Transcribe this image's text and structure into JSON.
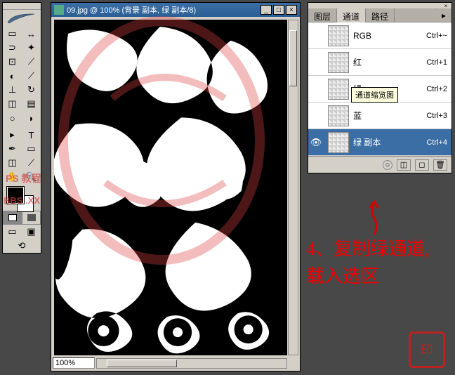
{
  "toolbox": {
    "tools": [
      "▭",
      "⬚",
      "⊡",
      "✎",
      "⟋",
      "⬛",
      "⬚",
      "⬚",
      "⬚",
      "✎",
      "⬚",
      "⬚",
      "⬚",
      "⬚",
      "⬚",
      "T",
      "⬚",
      "⬚",
      "⬚",
      "⬚",
      "⬚",
      "⬚"
    ]
  },
  "document": {
    "title": "09.jpg @ 100% (背景 副本, 绿 副本/8)",
    "zoom": "100%"
  },
  "panel": {
    "tabs": [
      {
        "label": "图层",
        "active": false
      },
      {
        "label": "通道",
        "active": true
      },
      {
        "label": "路径",
        "active": false
      }
    ],
    "channels": [
      {
        "name": "RGB",
        "shortcut": "Ctrl+~",
        "visible": false,
        "selected": false,
        "cls": "rgb"
      },
      {
        "name": "红",
        "shortcut": "Ctrl+1",
        "visible": false,
        "selected": false,
        "cls": "rgb"
      },
      {
        "name": "绿",
        "shortcut": "Ctrl+2",
        "visible": false,
        "selected": false,
        "cls": "rgb"
      },
      {
        "name": "蓝",
        "shortcut": "Ctrl+3",
        "visible": false,
        "selected": false,
        "cls": "rgb"
      },
      {
        "name": "绿 副本",
        "shortcut": "Ctrl+4",
        "visible": true,
        "selected": true,
        "cls": "rgb"
      }
    ],
    "tooltip": "通道缩览图"
  },
  "watermark": {
    "line1": "PS 教程",
    "line2": "BBS .XX"
  },
  "annotation": {
    "text": "4、复制绿通道,载入选区",
    "stamp": "印"
  }
}
